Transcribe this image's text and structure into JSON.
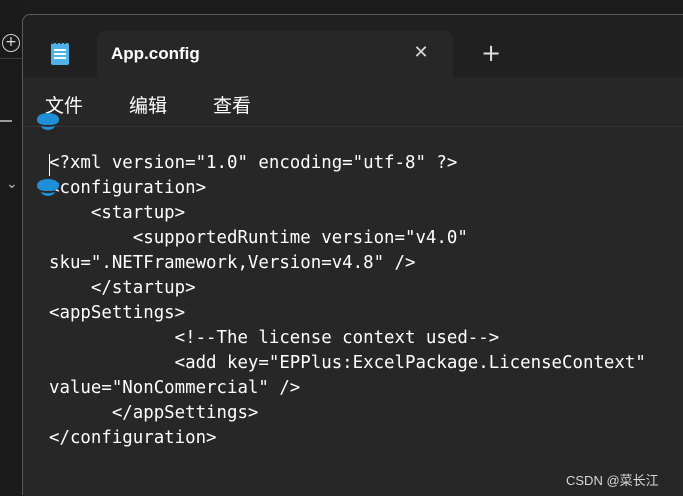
{
  "tab": {
    "title": "App.config"
  },
  "menu": {
    "items": [
      "文件",
      "编辑",
      "查看"
    ]
  },
  "editor": {
    "lines": [
      "<?xml version=\"1.0\" encoding=\"utf-8\" ?>",
      "<configuration>",
      "    <startup>",
      "        <supportedRuntime version=\"v4.0\"",
      "sku=\".NETFramework,Version=v4.8\" />",
      "    </startup>",
      "<appSettings>",
      "            <!--The license context used-->",
      "            <add key=\"EPPlus:ExcelPackage.LicenseContext\"",
      "value=\"NonCommercial\" />",
      "      </appSettings>",
      "</configuration>"
    ]
  },
  "watermark": "CSDN @菜长江",
  "icons": {
    "app": "notepad-icon",
    "close": "close-icon",
    "new_tab": "plus-icon",
    "behind_window_add": "add-circle-icon"
  }
}
